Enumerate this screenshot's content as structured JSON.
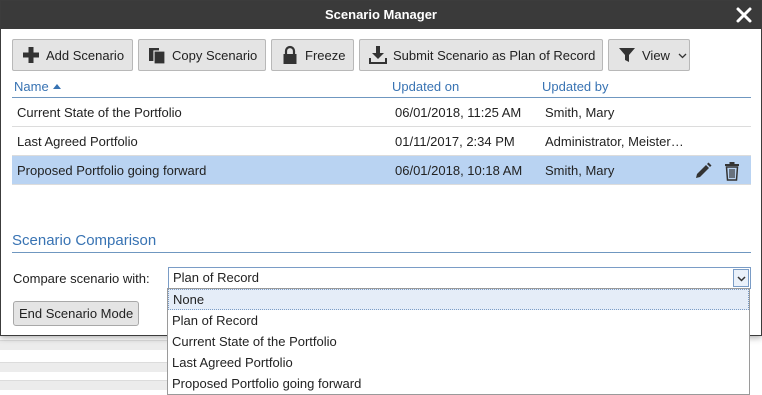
{
  "dialog": {
    "title": "Scenario Manager",
    "close_icon": "close-icon"
  },
  "toolbar": {
    "add": {
      "label": "Add Scenario",
      "icon": "plus-icon"
    },
    "copy": {
      "label": "Copy Scenario",
      "icon": "copy-icon"
    },
    "freeze": {
      "label": "Freeze",
      "icon": "lock-icon"
    },
    "submit": {
      "label": "Submit Scenario as Plan of Record",
      "icon": "download-icon"
    },
    "view": {
      "label": "View",
      "icon": "filter-icon"
    }
  },
  "table": {
    "headers": {
      "name": "Name",
      "updated_on": "Updated on",
      "updated_by": "Updated by"
    },
    "rows": [
      {
        "name": "Current State of the Portfolio",
        "updated_on": "06/01/2018, 11:25 AM",
        "updated_by": "Smith, Mary"
      },
      {
        "name": "Last Agreed Portfolio",
        "updated_on": "01/11/2017, 2:34 PM",
        "updated_by": "Administrator, Meister…"
      },
      {
        "name": "Proposed Portfolio going forward",
        "updated_on": "06/01/2018, 10:18 AM",
        "updated_by": "Smith, Mary",
        "selected": true
      }
    ]
  },
  "comparison": {
    "section_title": "Scenario Comparison",
    "label": "Compare scenario with:",
    "selected": "Plan of Record",
    "options": [
      "None",
      "Plan of Record",
      "Current State of the Portfolio",
      "Last Agreed Portfolio",
      "Proposed Portfolio going forward"
    ],
    "highlighted": "None"
  },
  "end_button": "End Scenario Mode",
  "colors": {
    "titlebar": "#3a3a3a",
    "header_text": "#3873b3",
    "selected_row": "#b9d3f2"
  }
}
